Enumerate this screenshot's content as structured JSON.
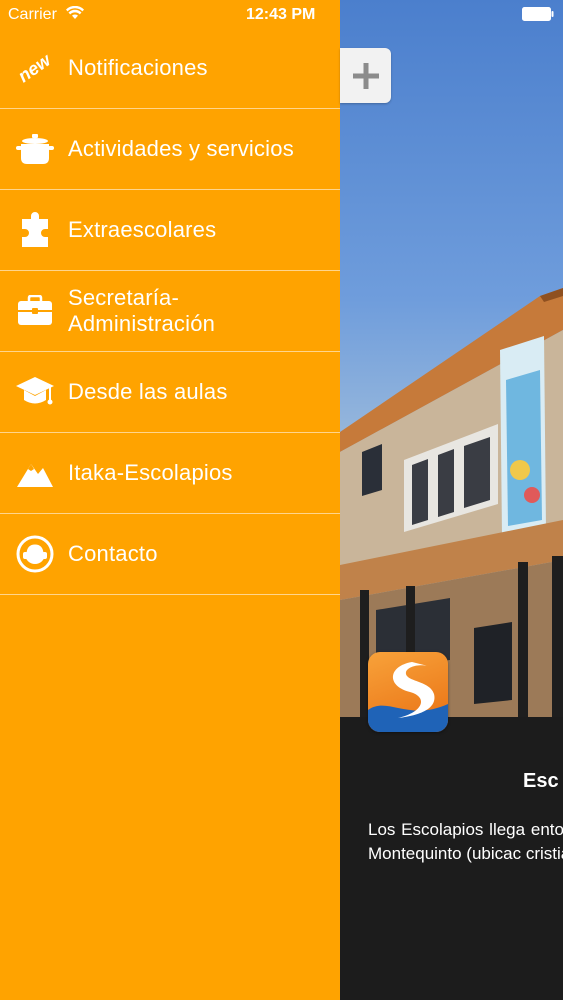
{
  "status_bar": {
    "carrier": "Carrier",
    "time": "12:43 PM"
  },
  "menu": {
    "items": [
      {
        "label": "Notificaciones",
        "icon": "new-badge-icon",
        "badge": "new"
      },
      {
        "label": "Actividades y servicios",
        "icon": "pot-icon"
      },
      {
        "label": "Extraescolares",
        "icon": "puzzle-piece-icon"
      },
      {
        "label_line1": "Secretaría-",
        "label_line2": "Administración",
        "icon": "briefcase-icon"
      },
      {
        "label": "Desde las aulas",
        "icon": "graduation-cap-icon"
      },
      {
        "label": "Itaka-Escolapios",
        "icon": "mountain-icon"
      },
      {
        "label": "Contacto",
        "icon": "person-headset-icon"
      }
    ]
  },
  "content": {
    "add_button_icon": "plus-icon",
    "school_title": "Esc",
    "description": "Los Escolapios llega entonces, primero Montequinto (ubicac cristiano."
  },
  "colors": {
    "menu_background": "#ffa300",
    "divider": "#ffffff",
    "text": "#ffffff",
    "content_panel": "#1c1c1c"
  }
}
